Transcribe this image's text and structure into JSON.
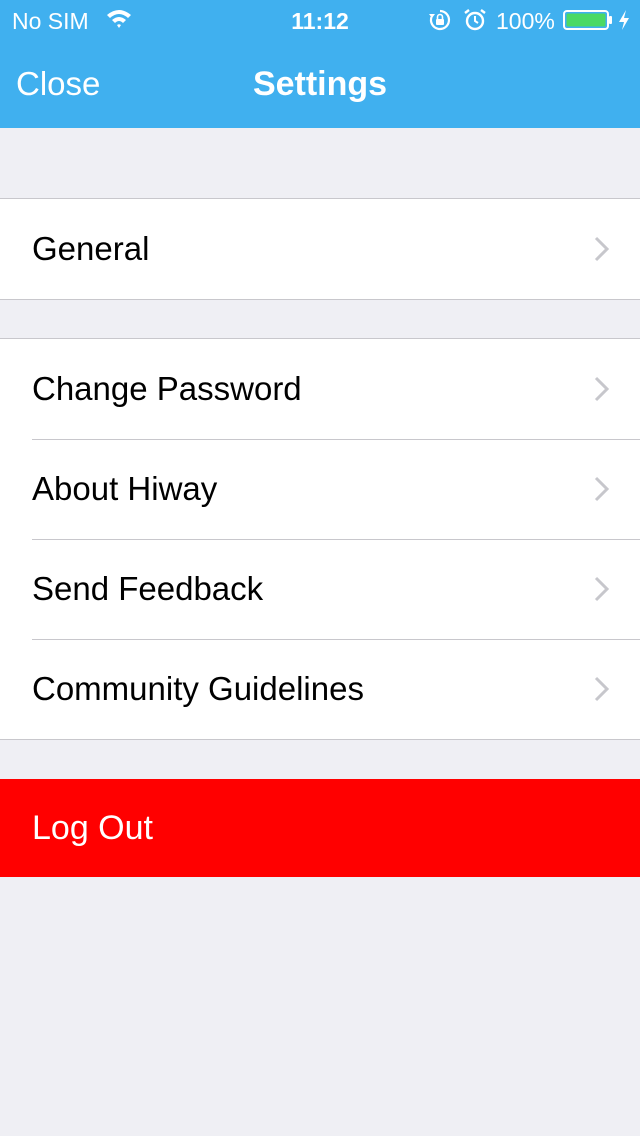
{
  "status_bar": {
    "carrier": "No SIM",
    "time": "11:12",
    "battery_percent": "100%",
    "battery_level": 1.0,
    "icons": [
      "wifi-icon",
      "orientation-lock-icon",
      "alarm-icon",
      "battery-icon",
      "charging-icon"
    ]
  },
  "nav": {
    "close_label": "Close",
    "title": "Settings"
  },
  "sections": [
    {
      "items": [
        {
          "label": "General",
          "icon": "chevron-right-icon"
        }
      ]
    },
    {
      "items": [
        {
          "label": "Change Password",
          "icon": "chevron-right-icon"
        },
        {
          "label": "About Hiway",
          "icon": "chevron-right-icon"
        },
        {
          "label": "Send Feedback",
          "icon": "chevron-right-icon"
        },
        {
          "label": "Community Guidelines",
          "icon": "chevron-right-icon"
        }
      ]
    }
  ],
  "logout": {
    "label": "Log Out"
  },
  "colors": {
    "nav_bar": "#40b0ef",
    "background": "#efeff4",
    "logout": "#ff0000",
    "separator": "#c8c7cc",
    "chevron": "#c7c7cc",
    "battery_fill": "#4cd964"
  }
}
